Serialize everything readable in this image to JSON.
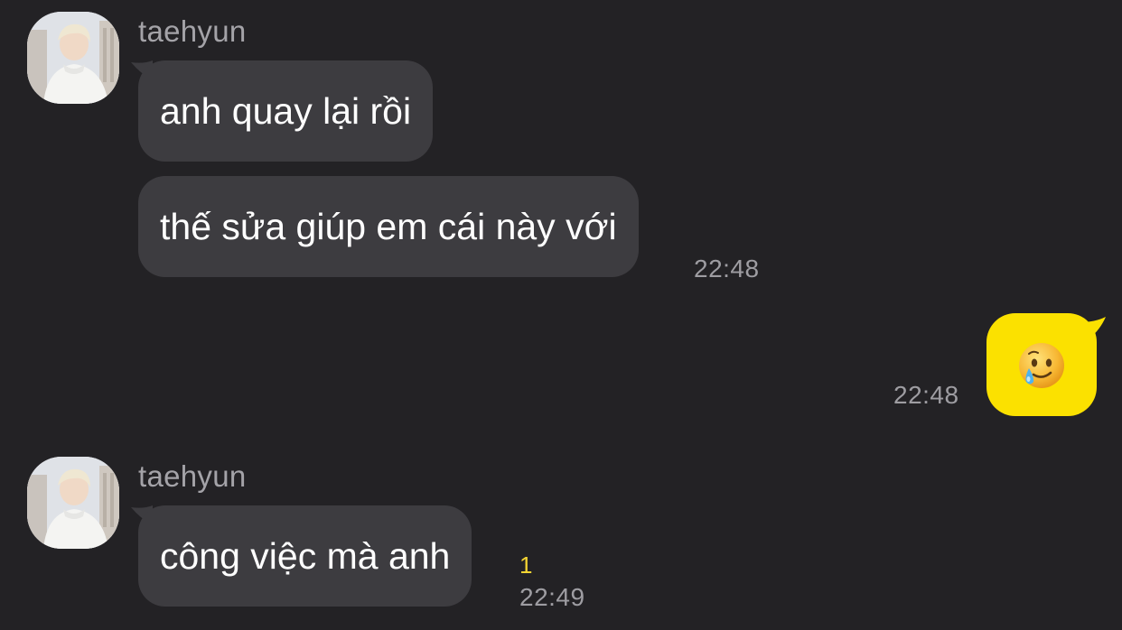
{
  "messages": [
    {
      "sender": "taehyun"
    },
    {
      "text": "anh quay lại rồi"
    },
    {
      "text": "thế sửa giúp em cái này với",
      "time": "22:48"
    },
    {
      "time": "22:48",
      "emoji": "face-holding-back-tears"
    },
    {
      "sender": "taehyun"
    },
    {
      "text": "công việc mà anh",
      "unread": "1",
      "time": "22:49"
    }
  ],
  "colors": {
    "background": "#232225",
    "incoming_bubble": "#3d3c40",
    "outgoing_bubble": "#fbe100",
    "unread": "#f5d533"
  }
}
